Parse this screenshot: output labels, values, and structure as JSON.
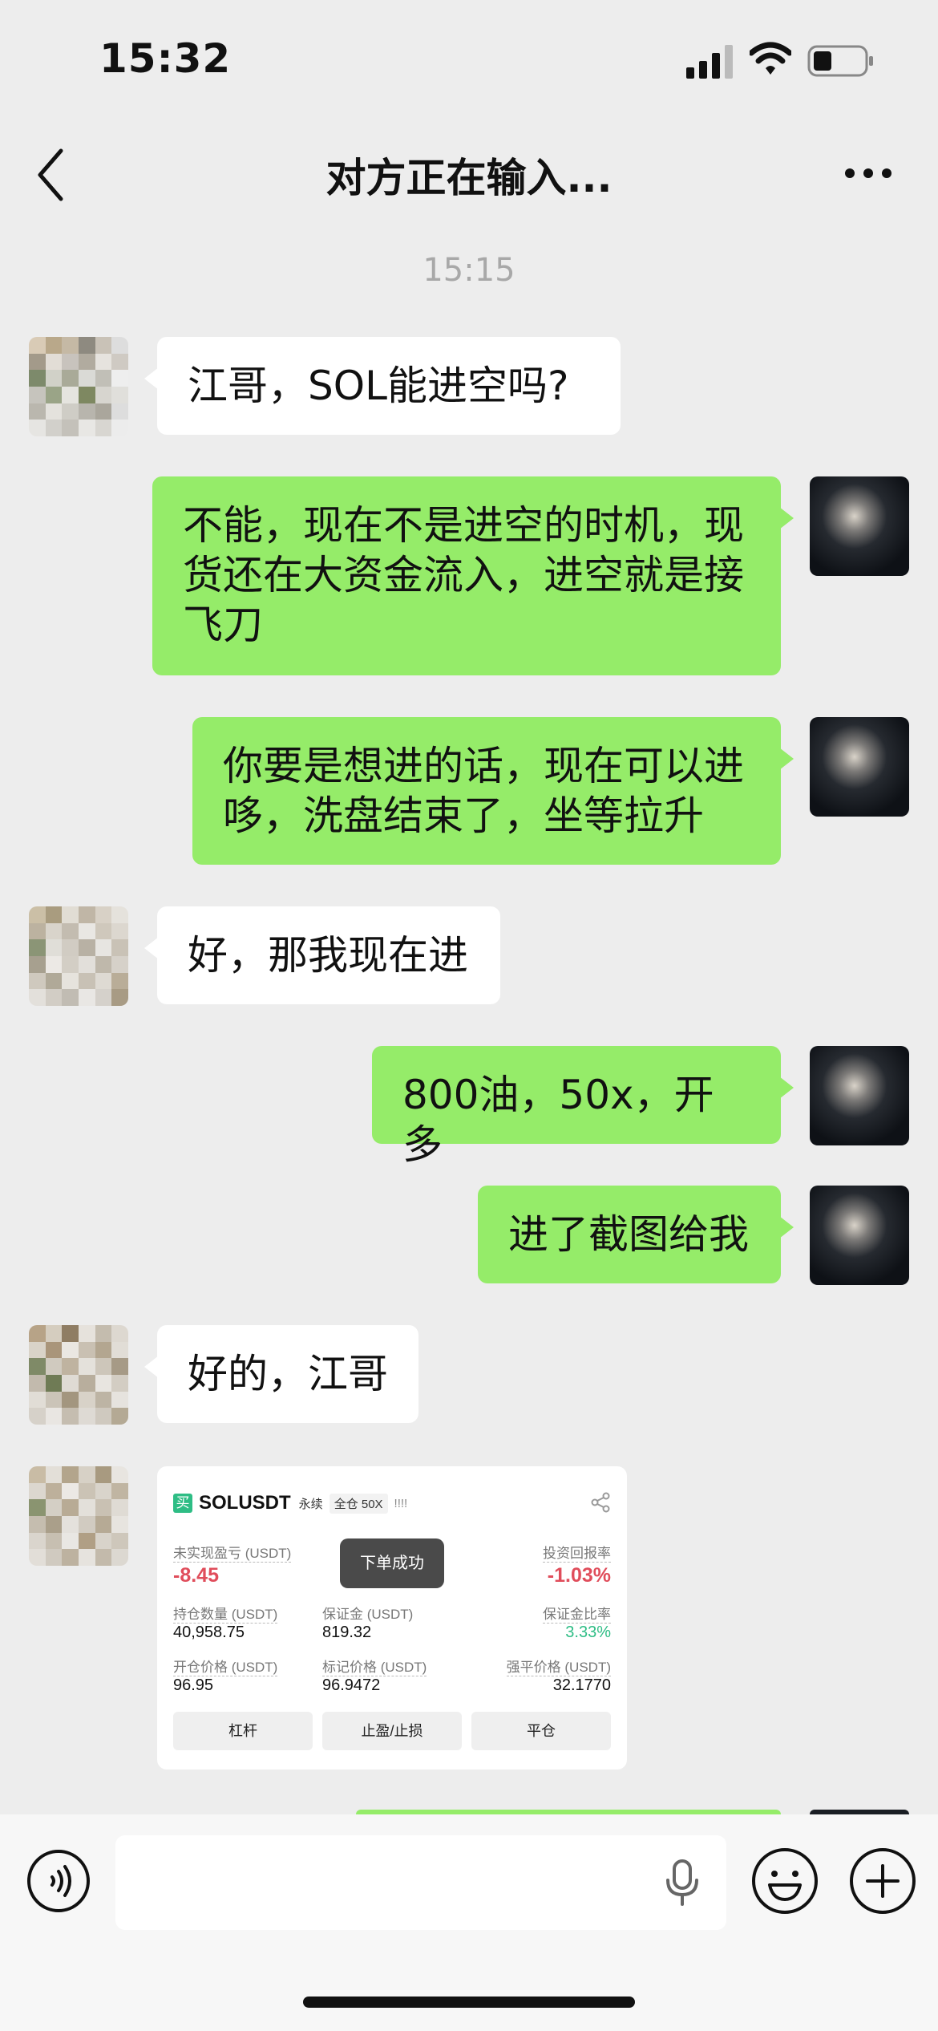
{
  "status_bar": {
    "time": "15:32"
  },
  "nav": {
    "title": "对方正在输入..."
  },
  "timestamp": "15:15",
  "messages": [
    {
      "side": "in",
      "text": "江哥，SOL能进空吗?"
    },
    {
      "side": "out",
      "lines": [
        "不能，现在不是进空的时机，现",
        "货还在大资金流入，进空就是接",
        "飞刀"
      ]
    },
    {
      "side": "out",
      "lines": [
        "你要是想进的话，现在可以进",
        "哆，洗盘结束了，坐等拉升"
      ]
    },
    {
      "side": "in",
      "text": "好，那我现在进"
    },
    {
      "side": "out",
      "text": "800油，50x，开多"
    },
    {
      "side": "out",
      "text": "进了截图给我"
    },
    {
      "side": "in",
      "text": "好的，江哥"
    }
  ],
  "trade_card": {
    "buy_badge": "买",
    "symbol": "SOLUSDT",
    "tag_perpetual": "永续",
    "tag_margin": "全仓 50X",
    "tag_bars": "!!!!",
    "toast": "下单成功",
    "unrealized_pnl_label": "未实现盈亏 (USDT)",
    "unrealized_pnl_value": "-8.45",
    "roi_label": "投资回报率",
    "roi_value": "-1.03%",
    "position_size_label": "持仓数量 (USDT)",
    "position_size_value": "40,958.75",
    "margin_label": "保证金 (USDT)",
    "margin_value": "819.32",
    "margin_ratio_label": "保证金比率",
    "margin_ratio_value": "3.33%",
    "entry_price_label": "开仓价格 (USDT)",
    "entry_price_value": "96.95",
    "mark_price_label": "标记价格 (USDT)",
    "mark_price_value": "96.9472",
    "liq_price_label": "强平价格 (USDT)",
    "liq_price_value": "32.1770",
    "buttons": [
      "杠杆",
      "止盈/止损",
      "平仓"
    ]
  },
  "input": {
    "value": "",
    "placeholder": ""
  },
  "colors": {
    "background": "#ededed",
    "bubble_out": "#95ec69",
    "bubble_in": "#ffffff",
    "loss_red": "#e04d5b",
    "gain_green": "#2ebd85"
  }
}
